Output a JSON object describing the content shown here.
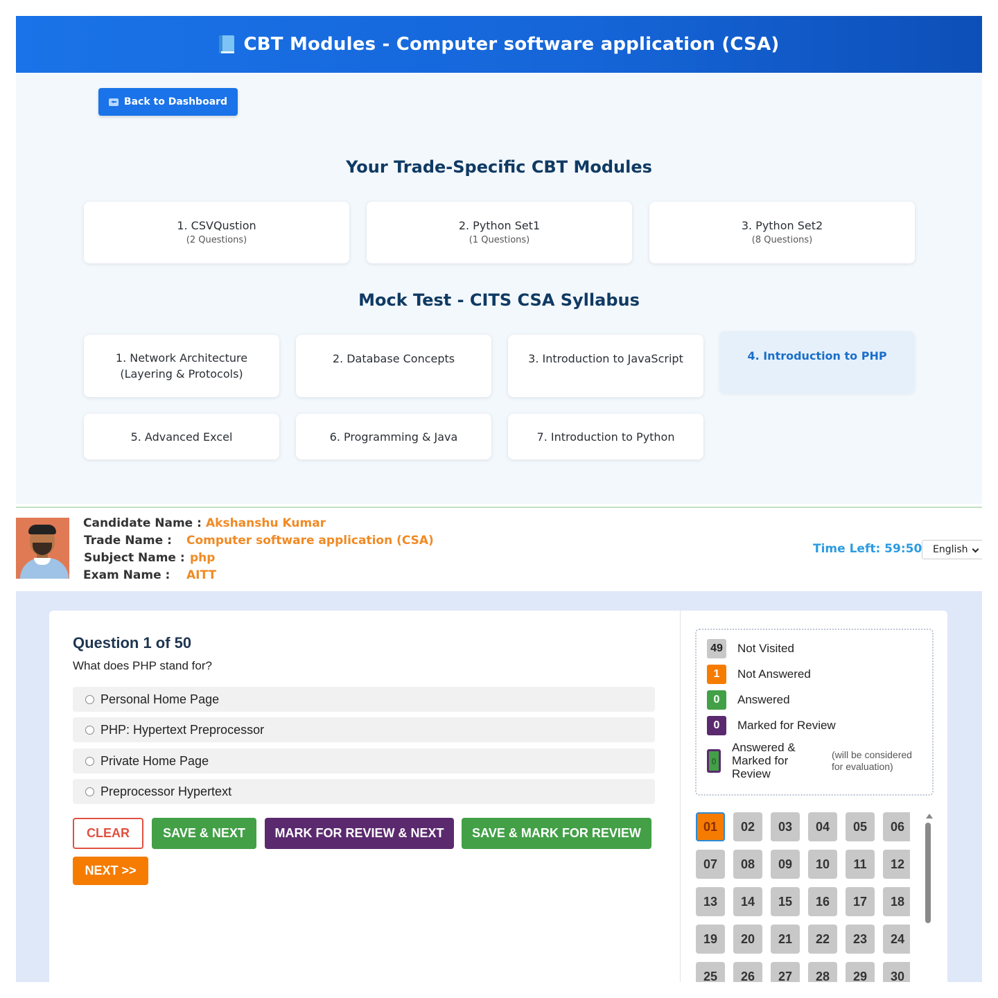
{
  "header": {
    "title": "CBT Modules - Computer software application (CSA)",
    "icon": "book-icon"
  },
  "back_button": {
    "label": "Back to Dashboard",
    "icon": "back-arrow-icon"
  },
  "trade_modules": {
    "title": "Your Trade-Specific CBT Modules",
    "items": [
      {
        "label": "1. CSVQustion",
        "count": "(2 Questions)"
      },
      {
        "label": "2. Python Set1",
        "count": "(1 Questions)"
      },
      {
        "label": "3. Python Set2",
        "count": "(8 Questions)"
      }
    ]
  },
  "mock_test": {
    "title": "Mock Test - CITS CSA Syllabus",
    "items": [
      {
        "line1": "1. Network Architecture",
        "line2": "(Layering & Protocols)"
      },
      {
        "line1": "2. Database Concepts"
      },
      {
        "line1": "3. Introduction to JavaScript"
      },
      {
        "line1": "4. Introduction to PHP",
        "active": true
      },
      {
        "line1": "5. Advanced Excel"
      },
      {
        "line1": "6. Programming & Java"
      },
      {
        "line1": "7. Introduction to Python"
      }
    ]
  },
  "candidate": {
    "name_label": "Candidate Name :",
    "name": "Akshanshu Kumar",
    "trade_label": "Trade Name :",
    "trade": "Computer software application (CSA)",
    "subject_label": "Subject Name :",
    "subject": "php",
    "exam_label": "Exam Name :",
    "exam": "AITT",
    "time_left": "Time Left: 59:50",
    "language": "English"
  },
  "question": {
    "title": "Question 1 of 50",
    "text": "What does PHP stand for?",
    "options": [
      "Personal Home Page",
      "PHP: Hypertext Preprocessor",
      "Private Home Page",
      "Preprocessor Hypertext"
    ]
  },
  "buttons": {
    "clear": "CLEAR",
    "save_next": "SAVE & NEXT",
    "mark_review_next": "MARK FOR REVIEW & NEXT",
    "save_mark_review": "SAVE & MARK FOR REVIEW",
    "next": "NEXT >>"
  },
  "legend": {
    "not_visited": {
      "count": "49",
      "label": "Not Visited"
    },
    "not_answered": {
      "count": "1",
      "label": "Not Answered"
    },
    "answered": {
      "count": "0",
      "label": "Answered"
    },
    "marked": {
      "count": "0",
      "label": "Marked for Review"
    },
    "answered_marked": {
      "count": "0",
      "line1": "Answered &",
      "line2": "Marked for",
      "line3": "Review",
      "note1": "(will be considered",
      "note2": "for evaluation)"
    }
  },
  "palette": {
    "current": "01",
    "numbers": [
      "01",
      "02",
      "03",
      "04",
      "05",
      "06",
      "07",
      "08",
      "09",
      "10",
      "11",
      "12",
      "13",
      "14",
      "15",
      "16",
      "17",
      "18",
      "19",
      "20",
      "21",
      "22",
      "23",
      "24",
      "25",
      "26",
      "27",
      "28",
      "29",
      "30"
    ]
  },
  "colors": {
    "header_blue": "#1a73e8",
    "accent_orange": "#f57c00",
    "answered_green": "#43a047",
    "review_purple": "#5b2a6e",
    "time_blue": "#2b9be0"
  }
}
